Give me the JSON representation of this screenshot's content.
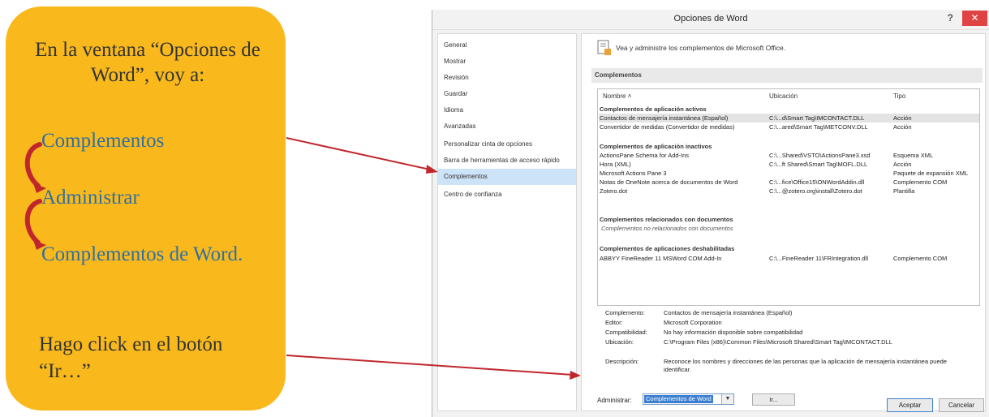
{
  "callout": {
    "intro": "En la ventana “Opciones de Word”, voy a:",
    "step1": "Complementos",
    "step2": "Administrar",
    "step3": "Complementos de Word.",
    "note": "Hago click en el botón “Ir…”"
  },
  "dialog": {
    "title": "Opciones de Word",
    "help": "?",
    "close": "✕",
    "nav": [
      "General",
      "Mostrar",
      "Revisión",
      "Guardar",
      "Idioma",
      "Avanzadas",
      "Personalizar cinta de opciones",
      "Barra de herramientas de acceso rápido",
      "Complementos",
      "Centro de confianza"
    ],
    "active_nav": "Complementos",
    "header_text": "Vea y administre los complementos de Microsoft Office.",
    "section_title": "Complementos",
    "columns": {
      "name": "Nombre ˄",
      "location": "Ubicación",
      "type": "Tipo"
    },
    "groups": {
      "active": "Complementos de aplicación activos",
      "inactive": "Complementos de aplicación inactivos",
      "docs": "Complementos relacionados con documentos",
      "disabled": "Complementos de aplicaciones deshabilitadas"
    },
    "active_rows": [
      {
        "name": "Contactos de mensajería instantánea (Español)",
        "loc": "C:\\...d\\Smart Tag\\IMCONTACT.DLL",
        "type": "Acción"
      },
      {
        "name": "Convertidor de medidas (Convertidor de medidas)",
        "loc": "C:\\...ared\\Smart Tag\\METCONV.DLL",
        "type": "Acción"
      }
    ],
    "inactive_rows": [
      {
        "name": "ActionsPane Schema for Add-Ins",
        "loc": "C:\\...Shared\\VSTO\\ActionsPane3.xsd",
        "type": "Esquema XML"
      },
      {
        "name": "Hora (XML)",
        "loc": "C:\\...ft Shared\\Smart Tag\\MOFL.DLL",
        "type": "Acción"
      },
      {
        "name": "Microsoft Actions Pane 3",
        "loc": "",
        "type": "Paquete de expansión XML"
      },
      {
        "name": "Notas de OneNote acerca de documentos de Word",
        "loc": "C:\\...fice\\Office15\\ONWordAddin.dll",
        "type": "Complemento COM"
      },
      {
        "name": "Zotero.dot",
        "loc": "C:\\...@zotero.org\\install\\Zotero.dot",
        "type": "Plantilla"
      }
    ],
    "docs_empty": "Complementos no relacionados con documentos",
    "disabled_rows": [
      {
        "name": "ABBYY FineReader 11 MSWord COM Add-In",
        "loc": "C:\\...FineReader 11\\FRIntegration.dll",
        "type": "Complemento COM"
      }
    ],
    "details": {
      "addin_label": "Complemento:",
      "addin_value": "Contactos de mensajería instantánea (Español)",
      "publisher_label": "Editor:",
      "publisher_value": "Microsoft Corporation",
      "compat_label": "Compatibilidad:",
      "compat_value": "No hay información disponible sobre compatibilidad",
      "location_label": "Ubicación:",
      "location_value": "C:\\Program Files (x86)\\Common Files\\Microsoft Shared\\Smart Tag\\IMCONTACT.DLL",
      "desc_label": "Descripción:",
      "desc_value": "Reconoce los nombres y direcciones de las personas que la aplicación de mensajería instantánea puede identificar."
    },
    "manage_label": "Administrar:",
    "manage_selected": "Complementos de Word",
    "go_button": "Ir...",
    "ok_button": "Aceptar",
    "cancel_button": "Cancelar"
  },
  "colors": {
    "callout": "#f9b91d",
    "step_text": "#2f6fa3",
    "arrow": "#c0272d",
    "selection": "#cde3f7"
  }
}
